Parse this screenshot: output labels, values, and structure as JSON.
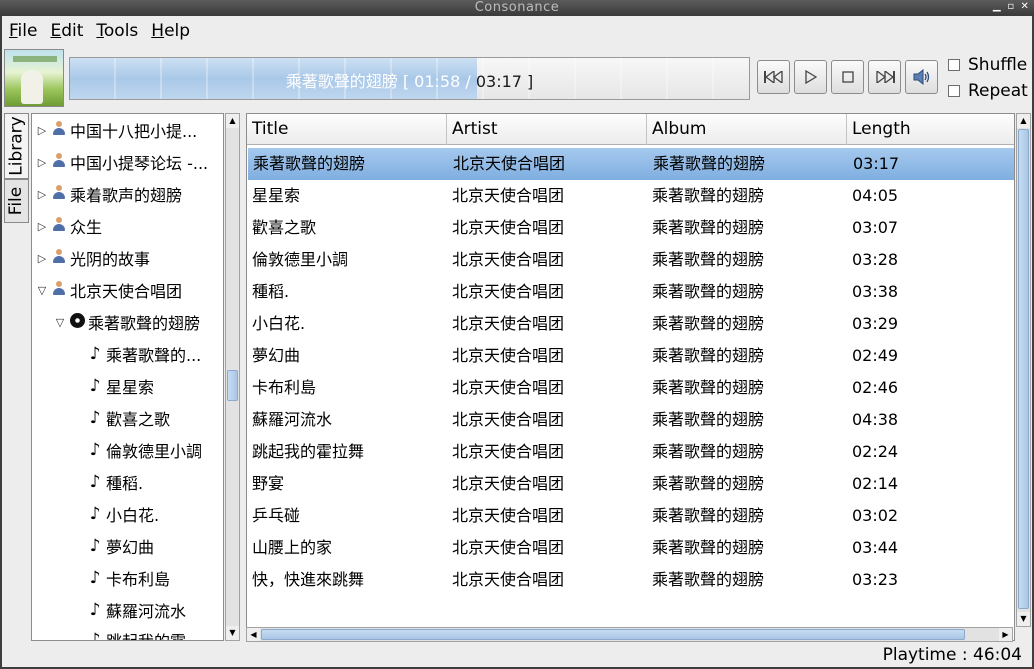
{
  "window": {
    "title": "Consonance"
  },
  "menu": [
    {
      "mnemonic": "F",
      "rest": "ile"
    },
    {
      "mnemonic": "E",
      "rest": "dit"
    },
    {
      "mnemonic": "T",
      "rest": "ools"
    },
    {
      "mnemonic": "H",
      "rest": "elp"
    }
  ],
  "player": {
    "track_title": "乘著歌聲的翅膀",
    "bracket_open": "[",
    "position": "01:58",
    "separator": "/",
    "duration": "03:17",
    "bracket_close": "]",
    "progress_fraction": 0.6
  },
  "controls": {
    "previous_icon": "previous-track-icon",
    "play_icon": "play-icon",
    "stop_icon": "stop-icon",
    "next_icon": "next-track-icon",
    "volume_icon": "volume-icon"
  },
  "options": {
    "shuffle_label": "Shuffle",
    "repeat_label": "Repeat"
  },
  "sidetabs": {
    "library_label": "Library",
    "file_label": "File"
  },
  "tree": {
    "artists": [
      "中国十八把小提...",
      "中国小提琴论坛 -...",
      "乘着歌声的翅膀",
      "众生",
      "光阴的故事",
      "北京天使合唱团"
    ],
    "album": "乘著歌聲的翅膀",
    "tracks": [
      "乘著歌聲的...",
      "星星索",
      "歡喜之歌",
      "倫敦德里小調",
      "種稻.",
      "小白花.",
      "夢幻曲",
      "卡布利島",
      "蘇羅河流水",
      "跳起我的霍..."
    ]
  },
  "playlist": {
    "columns": {
      "title": "Title",
      "artist": "Artist",
      "album": "Album",
      "length": "Length"
    },
    "rows": [
      {
        "title": "乘著歌聲的翅膀",
        "artist": "北京天使合唱团",
        "album": "乘著歌聲的翅膀",
        "length": "03:17"
      },
      {
        "title": "星星索",
        "artist": "北京天使合唱团",
        "album": "乘著歌聲的翅膀",
        "length": "04:05"
      },
      {
        "title": "歡喜之歌",
        "artist": "北京天使合唱团",
        "album": "乘著歌聲的翅膀",
        "length": "03:07"
      },
      {
        "title": "倫敦德里小調",
        "artist": "北京天使合唱团",
        "album": "乘著歌聲的翅膀",
        "length": "03:28"
      },
      {
        "title": "種稻.",
        "artist": "北京天使合唱团",
        "album": "乘著歌聲的翅膀",
        "length": "03:38"
      },
      {
        "title": "小白花.",
        "artist": "北京天使合唱团",
        "album": "乘著歌聲的翅膀",
        "length": "03:29"
      },
      {
        "title": "夢幻曲",
        "artist": "北京天使合唱团",
        "album": "乘著歌聲的翅膀",
        "length": "02:49"
      },
      {
        "title": "卡布利島",
        "artist": "北京天使合唱团",
        "album": "乘著歌聲的翅膀",
        "length": "02:46"
      },
      {
        "title": "蘇羅河流水",
        "artist": "北京天使合唱团",
        "album": "乘著歌聲的翅膀",
        "length": "04:38"
      },
      {
        "title": "跳起我的霍拉舞",
        "artist": "北京天使合唱团",
        "album": "乘著歌聲的翅膀",
        "length": "02:24"
      },
      {
        "title": "野宴",
        "artist": "北京天使合唱团",
        "album": "乘著歌聲的翅膀",
        "length": "02:14"
      },
      {
        "title": "乒乓碰",
        "artist": "北京天使合唱团",
        "album": "乘著歌聲的翅膀",
        "length": "03:02"
      },
      {
        "title": "山腰上的家",
        "artist": "北京天使合唱团",
        "album": "乘著歌聲的翅膀",
        "length": "03:44"
      },
      {
        "title": "快，快進來跳舞",
        "artist": "北京天使合唱团",
        "album": "乘著歌聲的翅膀",
        "length": "03:23"
      }
    ]
  },
  "status": {
    "playtime_label": "Playtime :",
    "playtime_value": "46:04"
  },
  "colors": {
    "selection": "#7faee0",
    "progress_fill": "#a9c8e8",
    "frame": "#3e3e3e"
  }
}
